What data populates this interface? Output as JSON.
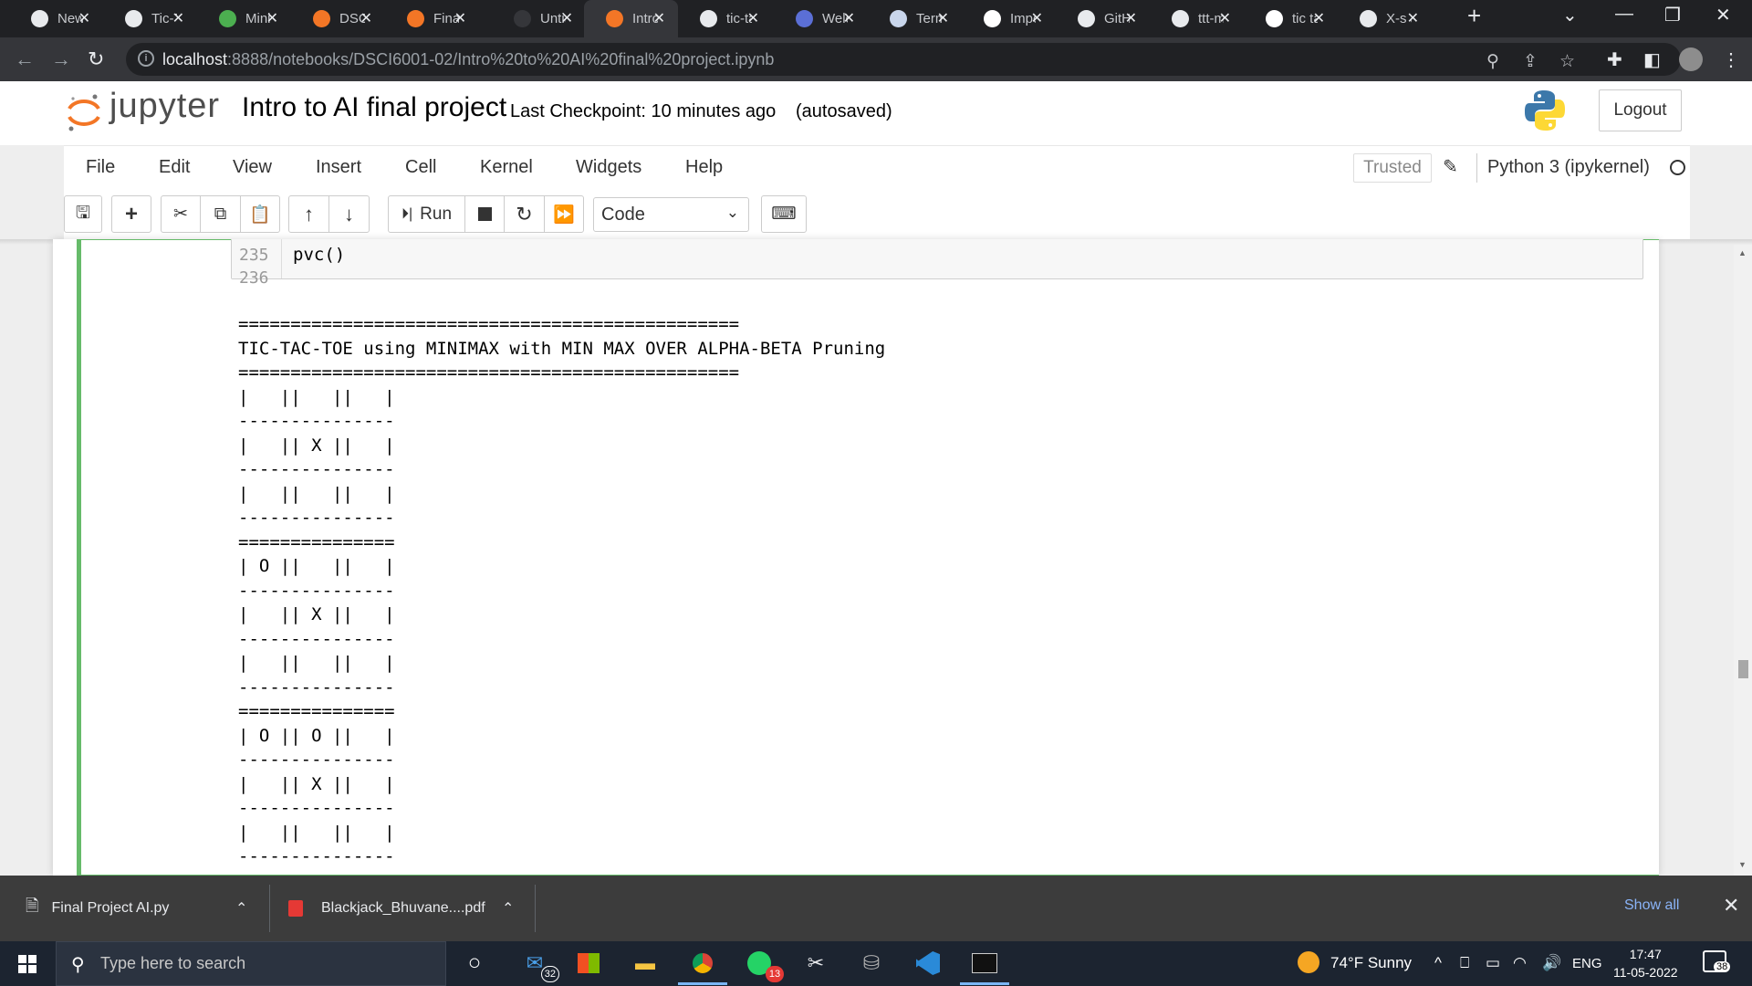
{
  "browser": {
    "tabs": [
      {
        "title": "New Tab",
        "icon": "chrome-icon",
        "color": "#e8eaed"
      },
      {
        "title": "Tic-Tac-Toe",
        "icon": "github-icon",
        "color": "#e8eaed"
      },
      {
        "title": "Minimax",
        "icon": "infinity-icon",
        "color": "#4caf50"
      },
      {
        "title": "DSCI",
        "icon": "loading-spinner-icon",
        "color": "#f37626"
      },
      {
        "title": "Final Project",
        "icon": "jupyter-notebook-icon",
        "color": "#f37626"
      },
      {
        "title": "Untitled",
        "icon": "blank-page-icon",
        "color": "#35363a"
      },
      {
        "title": "Intro to AI",
        "icon": "jupyter-notebook-icon",
        "color": "#f37626"
      },
      {
        "title": "tic-tac-toe",
        "icon": "github-icon",
        "color": "#e8eaed"
      },
      {
        "title": "Welcome",
        "icon": "globe-icon",
        "color": "#5b6fd6"
      },
      {
        "title": "Terminal",
        "icon": "terminal-doc-icon",
        "color": "#c9d6ec"
      },
      {
        "title": "Import",
        "icon": "google-icon",
        "color": "#ffffff"
      },
      {
        "title": "GitHub",
        "icon": "github-icon",
        "color": "#e8eaed"
      },
      {
        "title": "ttt-minimax",
        "icon": "github-icon",
        "color": "#e8eaed"
      },
      {
        "title": "tic tac toe",
        "icon": "google-icon",
        "color": "#ffffff"
      },
      {
        "title": "X-s and O-s",
        "icon": "github-icon",
        "color": "#e8eaed"
      }
    ],
    "active_tab_index": 6,
    "url_host": "localhost",
    "url_path": ":8888/notebooks/DSCI6001-02/Intro%20to%20AI%20final%20project.ipynb"
  },
  "jupyter": {
    "logo_text": "jupyter",
    "notebook_title": "Intro to AI final project",
    "checkpoint": "Last Checkpoint: 10 minutes ago",
    "autosaved": "(autosaved)",
    "logout": "Logout",
    "menu": [
      "File",
      "Edit",
      "View",
      "Insert",
      "Cell",
      "Kernel",
      "Widgets",
      "Help"
    ],
    "trusted": "Trusted",
    "kernel": "Python 3 (ipykernel)",
    "run_label": "Run",
    "cell_type": "Code",
    "accent": "#f37626",
    "cell_selected_color": "#66bb6a"
  },
  "cell": {
    "lines": [
      {
        "no": "235",
        "code": "pvc()"
      },
      {
        "no": "236",
        "code": ""
      }
    ],
    "output": "================================================\nTIC-TAC-TOE using MINIMAX with MIN MAX OVER ALPHA-BETA Pruning\n================================================\n|   ||   ||   |\n---------------\n|   || X ||   |\n---------------\n|   ||   ||   |\n---------------\n===============\n| O ||   ||   |\n---------------\n|   || X ||   |\n---------------\n|   ||   ||   |\n---------------\n===============\n| O || O ||   |\n---------------\n|   || X ||   |\n---------------\n|   ||   ||   |\n---------------"
  },
  "downloads": [
    {
      "name": "Final Project AI.py",
      "icon": "python-file-icon"
    },
    {
      "name": "Blackjack_Bhuvane....pdf",
      "icon": "pdf-file-icon"
    }
  ],
  "show_all": "Show all",
  "taskbar": {
    "search_placeholder": "Type here to search",
    "mail_badge": "32",
    "whatsapp_badge": "13",
    "weather": "74°F  Sunny",
    "lang": "ENG",
    "time": "17:47",
    "date": "11-05-2022",
    "notif_count": "38"
  }
}
